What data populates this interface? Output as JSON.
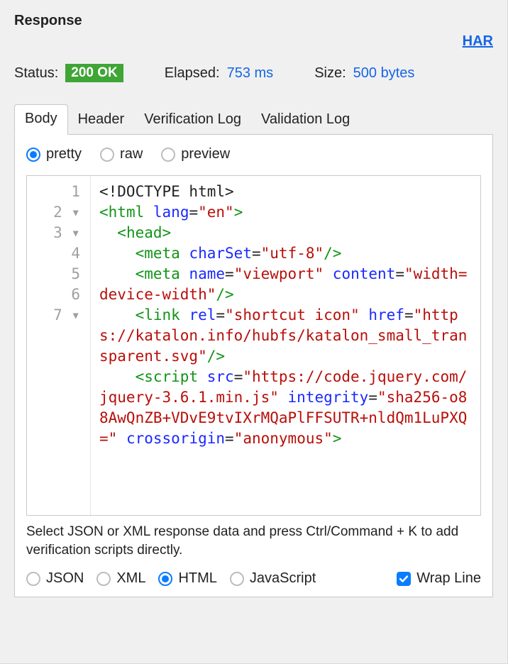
{
  "title": "Response",
  "har_label": "HAR",
  "status": {
    "label": "Status:",
    "badge": "200 OK",
    "elapsed_label": "Elapsed:",
    "elapsed_value": "753 ms",
    "size_label": "Size:",
    "size_value": "500 bytes"
  },
  "tabs": [
    "Body",
    "Header",
    "Verification Log",
    "Validation Log"
  ],
  "view_modes": [
    "pretty",
    "raw",
    "preview"
  ],
  "gutter": [
    "1",
    "2 ▾",
    "3 ▾",
    "4",
    "5",
    "",
    "6",
    "",
    "",
    "7 ▾",
    "",
    "",
    "",
    "",
    "",
    ""
  ],
  "code": {
    "l1_doctype": "<!DOCTYPE html>",
    "l2": {
      "open": "<",
      "tag": "html",
      "a1": "lang",
      "v1": "\"en\"",
      "close": ">"
    },
    "l3": {
      "indent": "  ",
      "open": "<",
      "tag": "head",
      "close": ">"
    },
    "l4": {
      "indent": "    ",
      "open": "<",
      "tag": "meta",
      "a1": "charSet",
      "v1": "\"utf-8\"",
      "close": "/>"
    },
    "l5": {
      "indent": "    ",
      "open": "<",
      "tag": "meta",
      "a1": "name",
      "v1": "\"viewport\"",
      "a2": "content",
      "v2": "\"width=device-width\"",
      "close": "/>"
    },
    "l6": {
      "indent": "    ",
      "open": "<",
      "tag": "link",
      "a1": "rel",
      "v1": "\"shortcut icon\"",
      "a2": "href",
      "v2": "\"https://katalon.info/hubfs/katalon_small_transparent.svg\"",
      "close": "/>"
    },
    "l7": {
      "indent": "    ",
      "open": "<",
      "tag": "script",
      "a1": "src",
      "v1": "\"https://code.jquery.com/jquery-3.6.1.min.js\"",
      "a2": "integrity",
      "v2": "\"sha256-o88AwQnZB+VDvE9tvIXrMQaPlFFSUTR+nldQm1LuPXQ=\"",
      "a3": "crossorigin",
      "v3": "\"anonymous\"",
      "close": ">"
    }
  },
  "hint": "Select JSON or XML response data and press Ctrl/Command + K to add verification scripts directly.",
  "format_radios": [
    "JSON",
    "XML",
    "HTML",
    "JavaScript"
  ],
  "wrap_label": "Wrap Line"
}
